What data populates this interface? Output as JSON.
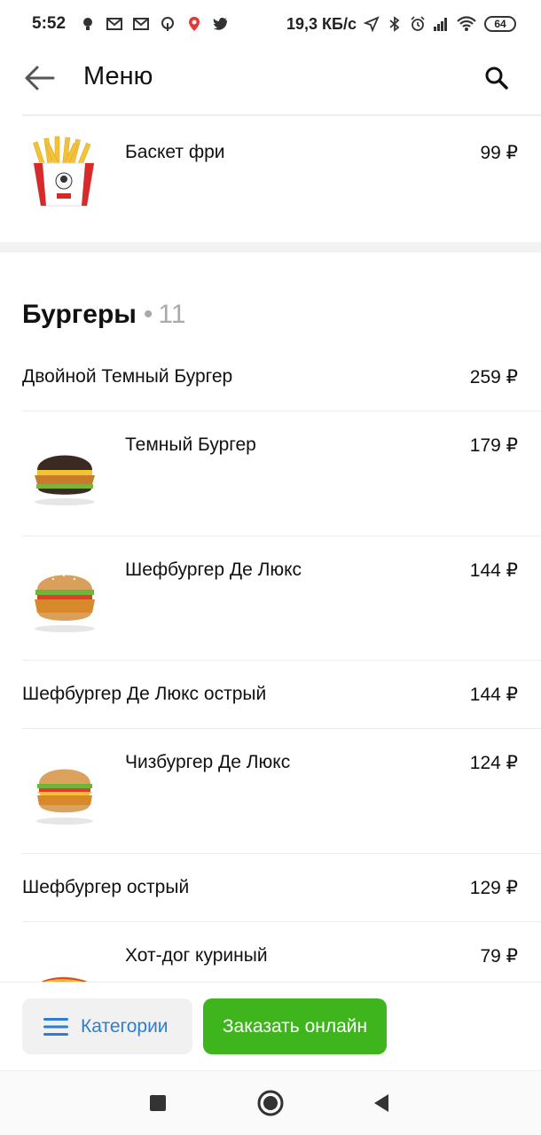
{
  "status_bar": {
    "time": "5:52",
    "net_speed": "19,3 КБ/с",
    "battery": "64",
    "left_icons": [
      "bulb-icon",
      "gmail-icon",
      "gmail-icon",
      "podcast-icon",
      "pin-icon",
      "twitter-icon"
    ],
    "right_icons": [
      "location-arrow-icon",
      "bluetooth-icon",
      "alarm-icon",
      "signal-icon",
      "wifi-icon"
    ]
  },
  "app_bar": {
    "title": "Меню"
  },
  "prev_item": {
    "name": "Баскет фри",
    "price": "99 ₽",
    "thumb": "fries-bucket"
  },
  "section": {
    "title": "Бургеры",
    "separator": "•",
    "count": "11"
  },
  "items": [
    {
      "name": "Двойной Темный Бургер",
      "price": "259 ₽",
      "thumb": null
    },
    {
      "name": "Темный Бургер",
      "price": "179 ₽",
      "thumb": "dark-burger"
    },
    {
      "name": "Шефбургер Де Люкс",
      "price": "144 ₽",
      "thumb": "chef-burger"
    },
    {
      "name": "Шефбургер Де Люкс острый",
      "price": "144 ₽",
      "thumb": null
    },
    {
      "name": "Чизбургер Де Люкс",
      "price": "124 ₽",
      "thumb": "cheese-burger"
    },
    {
      "name": "Шефбургер острый",
      "price": "129 ₽",
      "thumb": null
    },
    {
      "name": "Хот-дог куриный",
      "price": "79 ₽",
      "thumb": "hot-dog"
    }
  ],
  "bottom_bar": {
    "categories_label": "Категории",
    "order_label": "Заказать онлайн"
  },
  "colors": {
    "accent_blue": "#2d7dd2",
    "order_green": "#3eb51d"
  }
}
